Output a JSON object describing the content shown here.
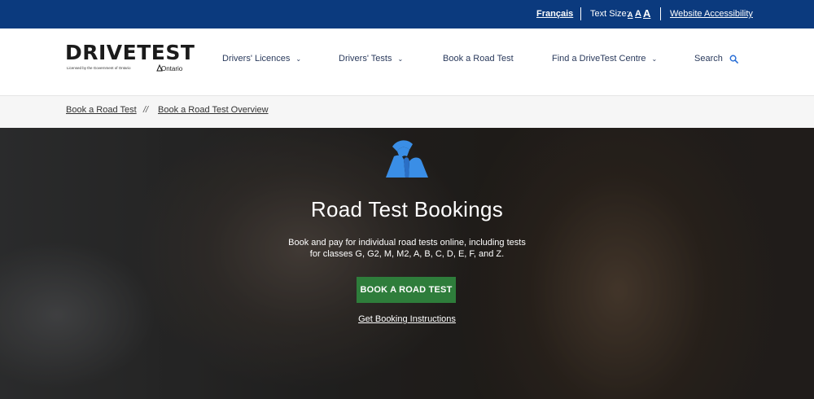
{
  "utility": {
    "language_link": "Français",
    "text_size_label": "Text Size:",
    "text_size_small": "A",
    "text_size_medium": "A",
    "text_size_large": "A",
    "accessibility_link": "Website Accessibility",
    "background_color": "#0b3a7e"
  },
  "header": {
    "logo": {
      "wordmark": "DRIVETEST",
      "tagline": "Licensed by the Government of Ontario",
      "partner": "Ontario"
    },
    "nav": [
      {
        "label": "Drivers' Licences",
        "has_dropdown": true
      },
      {
        "label": "Drivers' Tests",
        "has_dropdown": true
      },
      {
        "label": "Book a Road Test",
        "has_dropdown": false
      },
      {
        "label": "Find a DriveTest Centre",
        "has_dropdown": true
      },
      {
        "label": "Search",
        "icon": "search-icon"
      }
    ]
  },
  "breadcrumb": {
    "items": [
      "Book a Road Test",
      "Book a Road Test Overview"
    ],
    "separator": "//"
  },
  "hero": {
    "icon": "road-icon",
    "icon_color": "#3a8ee6",
    "title": "Road Test Bookings",
    "description": "Book and pay for individual road tests online, including tests for classes G, G2, M, M2, A, B, C, D, E, F, and Z.",
    "cta_label": "BOOK A ROAD TEST",
    "cta_color": "#2e7d3b",
    "instructions_link": "Get Booking Instructions"
  }
}
